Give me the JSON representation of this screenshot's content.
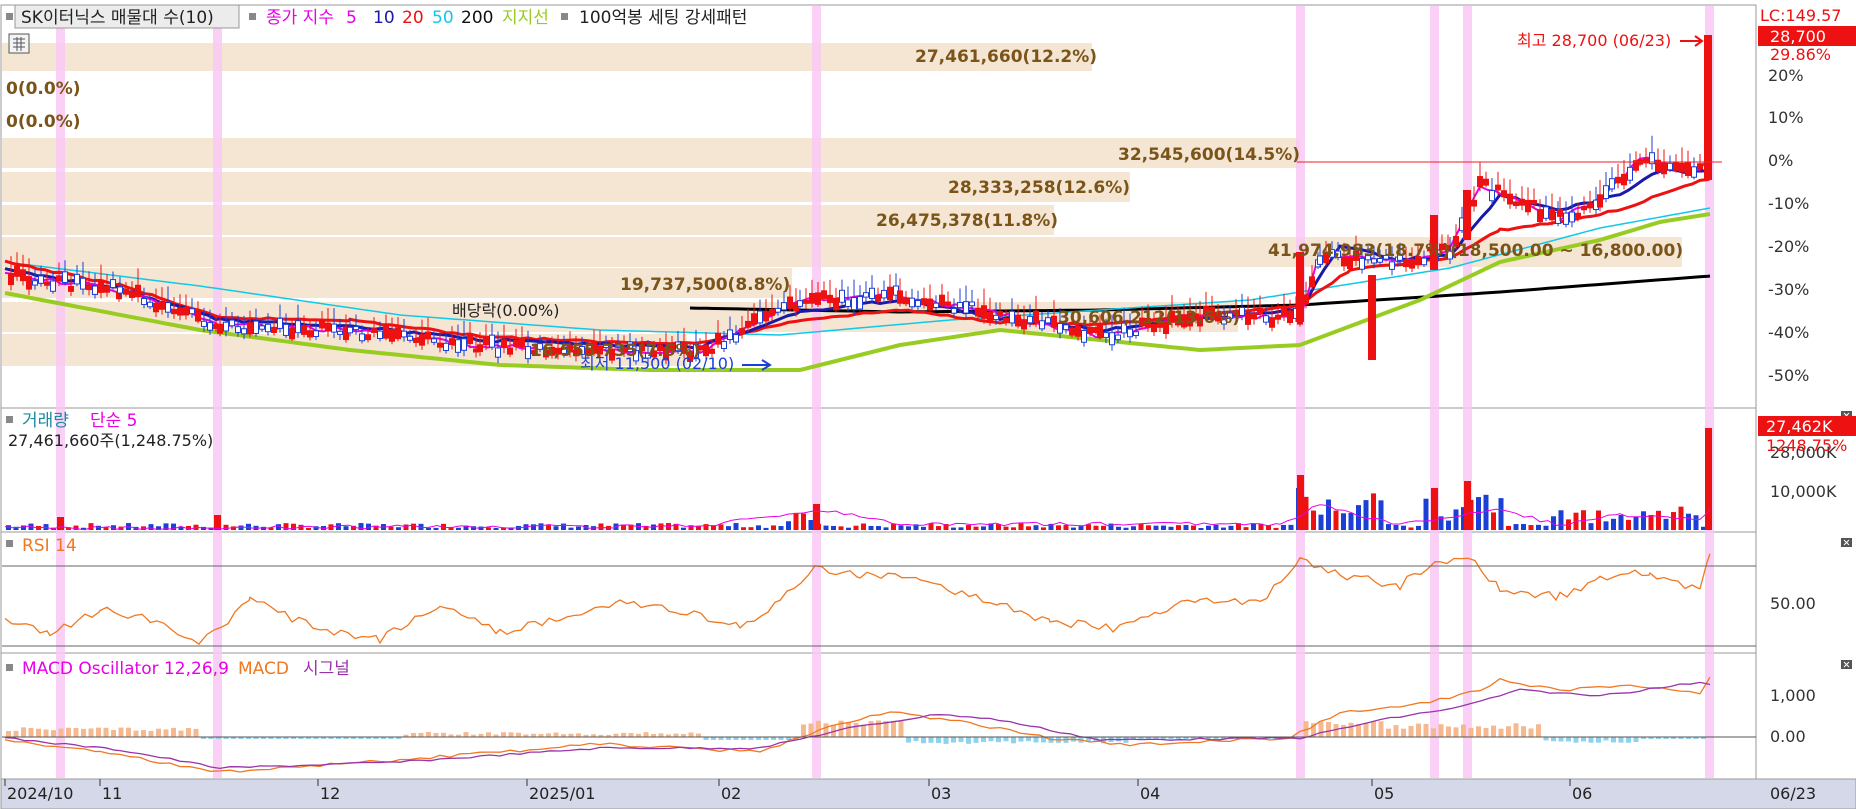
{
  "legend": {
    "title": "SK이터닉스 매물대 수(10)",
    "ma_label": "종가 지수",
    "ma5": "5",
    "ma10": "10",
    "ma20": "20",
    "ma50": "50",
    "ma200": "200",
    "support": "지지선",
    "setting": "100억봉 세팅 강세패턴"
  },
  "colors": {
    "ma5": "#e800e8",
    "ma10": "#1a1aa8",
    "ma20": "#ee1111",
    "ma50": "#11c8e8",
    "ma200": "#000000",
    "support": "#99cc22",
    "up": "#ee1111",
    "down": "#1c3fd6",
    "band": "#f5e6d3",
    "highlight": "#f9c8f5",
    "label": "#7a5418",
    "rsi": "#f07820",
    "macd": "#f07820",
    "signal": "#9933aa"
  },
  "price_panel": {
    "lc_label": "LC:149.57",
    "current_price": "28,700",
    "current_pct": "29.86%",
    "high_annotation": "최고 28,700 (06/23)",
    "low_annotation": "최저 11,500 (02/10)",
    "dividend_annotation": "배당락(0.00%)",
    "zero_labels": [
      "0(0.0%)",
      "0(0.0%)"
    ],
    "axis_labels": [
      "20%",
      "10%",
      "0%",
      "-10%",
      "-20%",
      "-30%",
      "-40%",
      "-50%"
    ]
  },
  "volume_panel": {
    "title": "거래량",
    "ma_label": "단순 5",
    "subtitle": "27,461,660주(1,248.75%)",
    "current_value": "27,462K",
    "current_pct": "1248.75%",
    "axis_labels": [
      "28,000K",
      "10,000K"
    ]
  },
  "rsi_panel": {
    "title": "RSI 14",
    "axis_label": "50.00"
  },
  "macd_panel": {
    "title": "MACD Oscillator 12,26,9",
    "macd_label": "MACD",
    "signal_label": "시그널",
    "axis_labels": [
      "1,000",
      "0.00"
    ]
  },
  "x_axis": {
    "labels": [
      "2024/10",
      "11",
      "12",
      "2025/01",
      "02",
      "03",
      "04",
      "05",
      "06"
    ],
    "current_date": "06/23"
  },
  "chart_data": {
    "type": "candlestick",
    "title": "SK이터닉스 매물대 수(10)",
    "price_high": {
      "value": 28700,
      "date": "06/23"
    },
    "price_low": {
      "value": 11500,
      "date": "02/10"
    },
    "volume_profile": [
      {
        "label": "27,461,660(12.2%)"
      },
      {
        "label": "32,545,600(14.5%)"
      },
      {
        "label": "28,333,258(12.6%)"
      },
      {
        "label": "26,475,378(11.8%)"
      },
      {
        "label": "41,974,983(18.7%)(18,500.00 ~ 16,800.00)"
      },
      {
        "label": "19,737,500(8.8%)"
      },
      {
        "label": "30,606,212(13.6%)"
      },
      {
        "label": "16,555,735(7.6%)"
      }
    ],
    "rsi_reference": 50,
    "current_volume": "27,461,660",
    "x_labels": [
      "2024/10",
      "11",
      "12",
      "2025/01",
      "02",
      "03",
      "04",
      "05",
      "06"
    ]
  }
}
